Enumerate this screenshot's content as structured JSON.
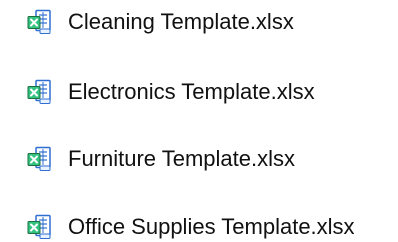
{
  "files": [
    {
      "name": "Cleaning Template.xlsx",
      "icon": "excel-file-icon"
    },
    {
      "name": "Electronics Template.xlsx",
      "icon": "excel-file-icon"
    },
    {
      "name": "Furniture Template.xlsx",
      "icon": "excel-file-icon"
    },
    {
      "name": "Office Supplies Template.xlsx",
      "icon": "excel-file-icon"
    }
  ],
  "colors": {
    "excel_green": "#1D6F42",
    "excel_light": "#33C481",
    "grid_blue": "#2E6FD1",
    "text": "#111111"
  }
}
